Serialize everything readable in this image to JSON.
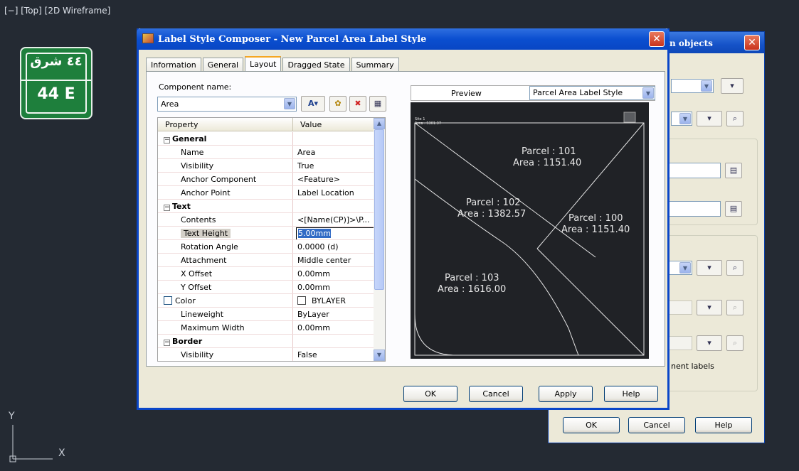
{
  "viewport": {
    "label": "[−] [Top] [2D Wireframe]"
  },
  "sign": {
    "arabic": "٤٤ شرق",
    "english": "44 E"
  },
  "ucs": {
    "y": "Y",
    "x": "X"
  },
  "back_dialog": {
    "title": "n objects",
    "partial_label": "nent labels",
    "buttons": {
      "ok": "OK",
      "cancel": "Cancel",
      "help": "Help"
    }
  },
  "main_dialog": {
    "title": "Label Style Composer - New Parcel Area Label Style",
    "tabs": [
      "Information",
      "General",
      "Layout",
      "Dragged State",
      "Summary"
    ],
    "active_tab": "Layout",
    "component_name_label": "Component name:",
    "component_name_value": "Area",
    "grid": {
      "headers": [
        "Property",
        "Value"
      ],
      "rows": [
        {
          "type": "category",
          "property": "General",
          "value": ""
        },
        {
          "type": "item",
          "property": "Name",
          "value": "Area"
        },
        {
          "type": "item",
          "property": "Visibility",
          "value": "True"
        },
        {
          "type": "item",
          "property": "Anchor Component",
          "value": "<Feature>"
        },
        {
          "type": "item",
          "property": "Anchor Point",
          "value": "Label Location"
        },
        {
          "type": "category",
          "property": "Text",
          "value": ""
        },
        {
          "type": "item",
          "property": "Contents",
          "value": "<[Name(CP)]>\\P..."
        },
        {
          "type": "item",
          "property": "Text Height",
          "value": "5.00mm"
        },
        {
          "type": "item",
          "property": "Rotation Angle",
          "value": "0.0000 (d)"
        },
        {
          "type": "item",
          "property": "Attachment",
          "value": "Middle center"
        },
        {
          "type": "item",
          "property": "X Offset",
          "value": "0.00mm"
        },
        {
          "type": "item",
          "property": "Y Offset",
          "value": "0.00mm"
        },
        {
          "type": "item",
          "property": "Color",
          "value": "BYLAYER"
        },
        {
          "type": "item",
          "property": "Lineweight",
          "value": "ByLayer"
        },
        {
          "type": "item",
          "property": "Maximum Width",
          "value": "0.00mm"
        },
        {
          "type": "category",
          "property": "Border",
          "value": ""
        },
        {
          "type": "item",
          "property": "Visibility",
          "value": "False"
        }
      ]
    },
    "preview": {
      "label": "Preview",
      "style_value": "Parcel Area Label Style",
      "site_label": "Site 1",
      "site_area": "Area : 5301.37",
      "parcels": [
        {
          "name": "Parcel : 101",
          "area": "Area : 1151.40"
        },
        {
          "name": "Parcel : 102",
          "area": "Area : 1382.57"
        },
        {
          "name": "Parcel : 100",
          "area": "Area : 1151.40"
        },
        {
          "name": "Parcel : 103",
          "area": "Area : 1616.00"
        }
      ]
    },
    "buttons": {
      "ok": "OK",
      "cancel": "Cancel",
      "apply": "Apply",
      "help": "Help"
    }
  },
  "colors": {
    "title_blue": "#0b4fd0",
    "dialog_bg": "#ece9d8",
    "sign_green": "#1e7f3c",
    "preview_bg": "#202226"
  },
  "icons": [
    "dialog-app-icon",
    "close-icon",
    "text-component-icon",
    "copy-component-icon",
    "delete-component-icon",
    "draw-order-icon",
    "dropdown-arrow-icon",
    "pick-icon"
  ]
}
